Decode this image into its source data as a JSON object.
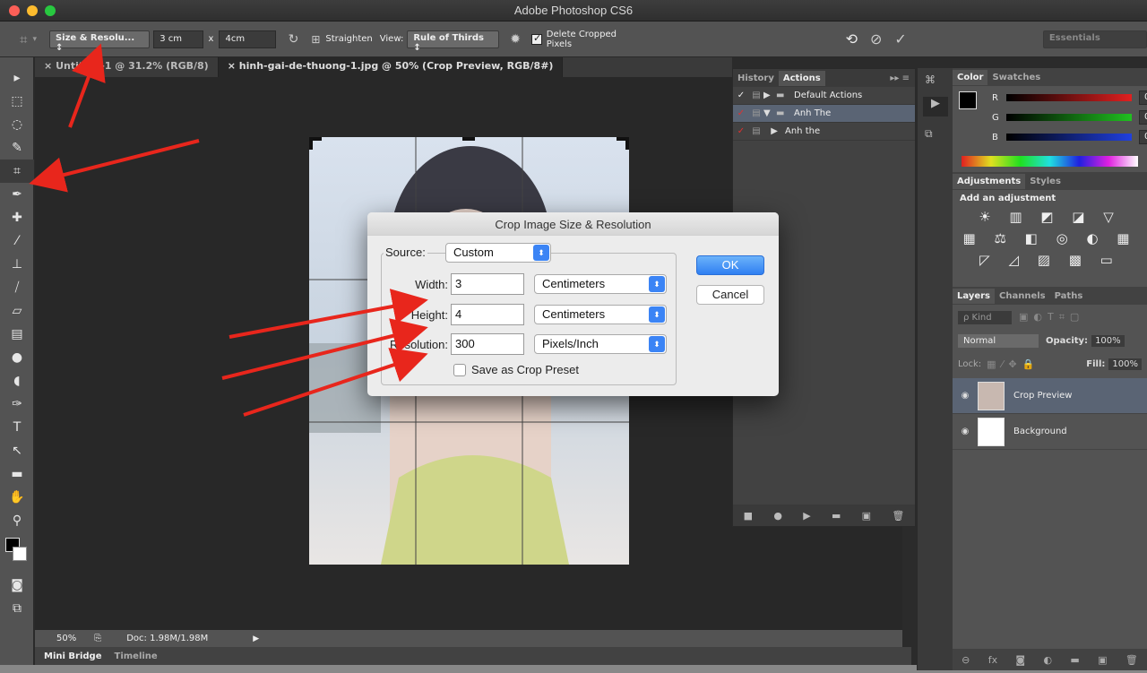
{
  "app": {
    "title": "Adobe Photoshop CS6"
  },
  "options_bar": {
    "preset": "Size & Resolu... ↕",
    "width_value": "3 cm",
    "x_label": "x",
    "height_value": "4cm",
    "straighten_label": "Straighten",
    "view_label": "View:",
    "view_value": "Rule of Thirds ↕",
    "delete_cropped_label": "Delete Cropped Pixels",
    "workspace": "Essentials"
  },
  "document_tabs": [
    {
      "label": "Untitled-1 @ 31.2% (RGB/8)",
      "close": "×"
    },
    {
      "label": "hinh-gai-de-thuong-1.jpg @ 50% (Crop Preview, RGB/8#)",
      "close": "×"
    }
  ],
  "status_bar": {
    "zoom": "50%",
    "doc": "Doc: 1.98M/1.98M"
  },
  "bottom_tabs": [
    "Mini Bridge",
    "Timeline"
  ],
  "actions_panel": {
    "tabs": [
      "History",
      "Actions"
    ],
    "rows": [
      {
        "label": "Default Actions",
        "expanded": false,
        "type": "folder"
      },
      {
        "label": "Anh The",
        "expanded": true,
        "type": "folder"
      },
      {
        "label": "Anh the",
        "expanded": false,
        "type": "action"
      }
    ]
  },
  "color_panel": {
    "tabs": [
      "Color",
      "Swatches"
    ],
    "channels": [
      {
        "name": "R",
        "value": "0",
        "color": "#e02020"
      },
      {
        "name": "G",
        "value": "0",
        "color": "#20c020"
      },
      {
        "name": "B",
        "value": "0",
        "color": "#2040e0"
      }
    ]
  },
  "adjustments_panel": {
    "tabs": [
      "Adjustments",
      "Styles"
    ],
    "heading": "Add an adjustment"
  },
  "layers_panel": {
    "tabs": [
      "Layers",
      "Channels",
      "Paths"
    ],
    "kind": "ρ Kind",
    "blend_mode": "Normal",
    "opacity_label": "Opacity:",
    "opacity_value": "100%",
    "lock_label": "Lock:",
    "fill_label": "Fill:",
    "fill_value": "100%",
    "layers": [
      {
        "name": "Crop Preview",
        "selected": true
      },
      {
        "name": "Background",
        "selected": false
      }
    ]
  },
  "dialog": {
    "title": "Crop Image Size & Resolution",
    "source_label": "Source:",
    "source_value": "Custom",
    "width_label": "Width:",
    "width_value": "3",
    "width_unit": "Centimeters",
    "height_label": "Height:",
    "height_value": "4",
    "height_unit": "Centimeters",
    "resolution_label": "Resolution:",
    "resolution_value": "300",
    "resolution_unit": "Pixels/Inch",
    "save_preset_label": "Save as Crop Preset",
    "ok_label": "OK",
    "cancel_label": "Cancel"
  },
  "colors": {
    "accent": "#3b84f5",
    "annotation_arrow": "#e8261c",
    "panel_bg": "#535353"
  }
}
